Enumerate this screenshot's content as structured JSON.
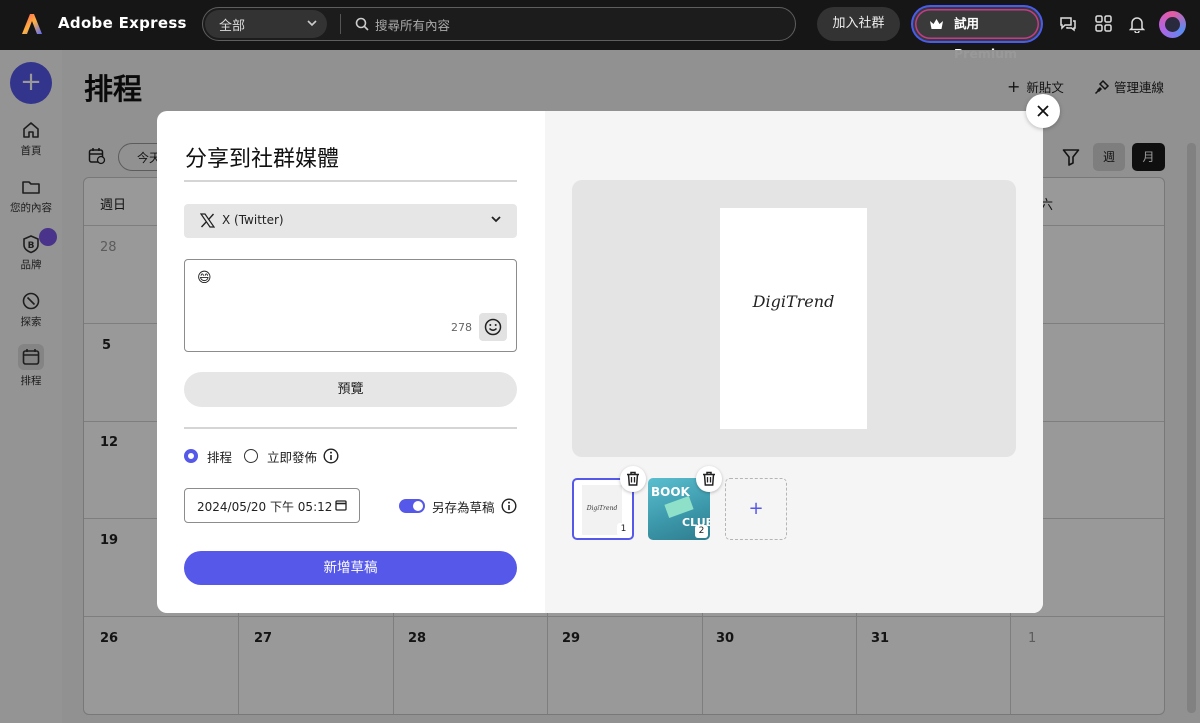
{
  "app": {
    "name": "Adobe Express",
    "search_category": "全部",
    "search_placeholder": "搜尋所有內容",
    "join_label": "加入社群",
    "premium_label": "試用 Premium"
  },
  "sidebar": {
    "create_label": "+",
    "items": [
      {
        "label": "首頁",
        "icon": "home-icon"
      },
      {
        "label": "您的內容",
        "icon": "folder-icon"
      },
      {
        "label": "品牌",
        "icon": "brand-icon"
      },
      {
        "label": "探索",
        "icon": "discover-icon"
      },
      {
        "label": "排程",
        "icon": "calendar-icon"
      }
    ]
  },
  "page": {
    "title": "排程",
    "new_post_label": "新貼文",
    "manage_connections_label": "管理連線",
    "today_label": "今天",
    "week_label": "週",
    "month_label": "月"
  },
  "calendar": {
    "weekdays": [
      "週日",
      "六"
    ],
    "rows": [
      [
        "28"
      ],
      [
        "5"
      ],
      [
        "12"
      ],
      [
        "19"
      ],
      [
        "26",
        "27",
        "28",
        "29",
        "30",
        "31",
        "1"
      ]
    ]
  },
  "modal": {
    "title": "分享到社群媒體",
    "platform": "X (Twitter)",
    "post_emoji": "😄",
    "char_count": "278",
    "preview_label": "預覽",
    "schedule_label": "排程",
    "publish_now_label": "立即發佈",
    "schedule_selected": "schedule",
    "datetime_value": "2024/05/20 下午 05:12",
    "save_draft_label": "另存為草稿",
    "save_draft_on": true,
    "primary_button": "新增草稿",
    "preview_text": "DigiTrend",
    "thumbnails": [
      {
        "index": "1",
        "text": "DigiTrend"
      },
      {
        "index": "2",
        "text_top": "BOOK",
        "text_bottom": "CLUB"
      }
    ],
    "add_label": "+"
  },
  "colors": {
    "accent": "#5558e8",
    "topbar": "#161616"
  }
}
